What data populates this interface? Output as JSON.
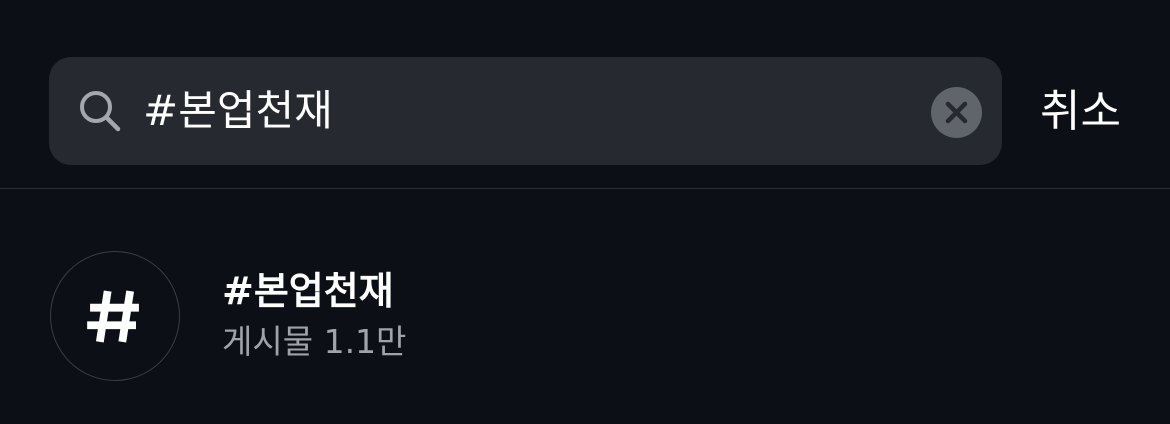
{
  "search": {
    "value": "#본업천재",
    "placeholder": "",
    "cancel_label": "취소"
  },
  "results": [
    {
      "icon": "hashtag-icon",
      "title": "#본업천재",
      "meta": "게시물 1.1만"
    }
  ],
  "colors": {
    "background": "#0c0f15",
    "search_field": "#262930",
    "clear_button": "#60646b",
    "secondary_text": "#9fa3aa",
    "divider": "#2a2d33"
  }
}
